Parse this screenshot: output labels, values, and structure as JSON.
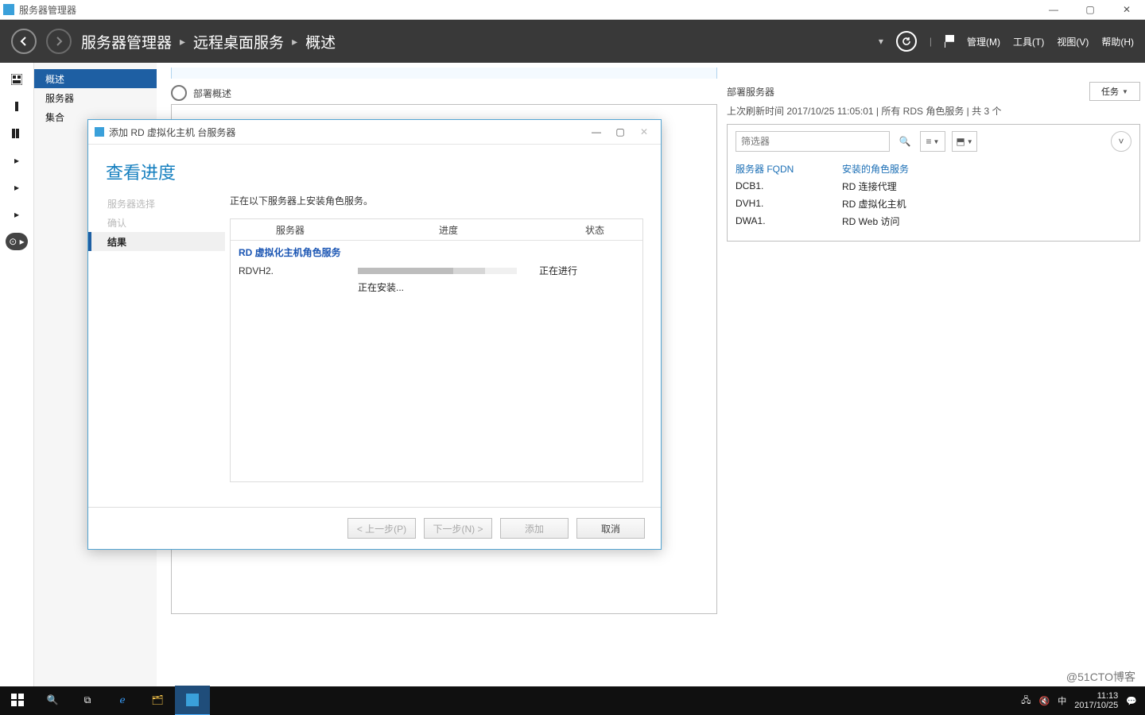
{
  "window": {
    "title": "服务器管理器"
  },
  "titlebar_controls": {
    "min": "—",
    "max": "▢",
    "close": "✕"
  },
  "header": {
    "breadcrumb": [
      "服务器管理器",
      "远程桌面服务",
      "概述"
    ],
    "menus": [
      "管理(M)",
      "工具(T)",
      "视图(V)",
      "帮助(H)"
    ]
  },
  "left_rail": {
    "items": [
      "dashboard",
      "local",
      "all",
      "ad",
      "file",
      "rds"
    ]
  },
  "side": {
    "items": [
      "概述",
      "服务器",
      "集合"
    ],
    "selected": 0
  },
  "main_left": {
    "section": "部署概述"
  },
  "main_right": {
    "section": "部署服务器",
    "last_refresh": "上次刷新时间 2017/10/25 11:05:01 | 所有 RDS 角色服务 | 共 3 个",
    "task_btn": "任务",
    "filter_placeholder": "筛选器",
    "table_head": [
      "服务器 FQDN",
      "安装的角色服务"
    ],
    "rows": [
      {
        "fqdn": "DCB1.",
        "role": "RD 连接代理"
      },
      {
        "fqdn": "DVH1.",
        "role": "RD 虚拟化主机"
      },
      {
        "fqdn": "DWA1.",
        "role": "RD Web 访问"
      }
    ]
  },
  "dialog": {
    "title": "添加 RD 虚拟化主机 台服务器",
    "heading": "查看进度",
    "steps": [
      {
        "label": "服务器选择",
        "state": "disabled"
      },
      {
        "label": "确认",
        "state": "disabled"
      },
      {
        "label": "结果",
        "state": "sel"
      }
    ],
    "msg": "正在以下服务器上安装角色服务。",
    "cols": [
      "服务器",
      "进度",
      "状态"
    ],
    "role_group": "RD 虚拟化主机角色服务",
    "row": {
      "server": "RDVH2.",
      "status": "正在进行",
      "sub": "正在安装..."
    },
    "buttons": {
      "prev": "< 上一步(P)",
      "next": "下一步(N) >",
      "add": "添加",
      "cancel": "取消"
    }
  },
  "taskbar": {
    "tray": {
      "ime": "中",
      "time": "11:13",
      "date": "2017/10/25"
    }
  },
  "watermark": "@51CTO博客"
}
